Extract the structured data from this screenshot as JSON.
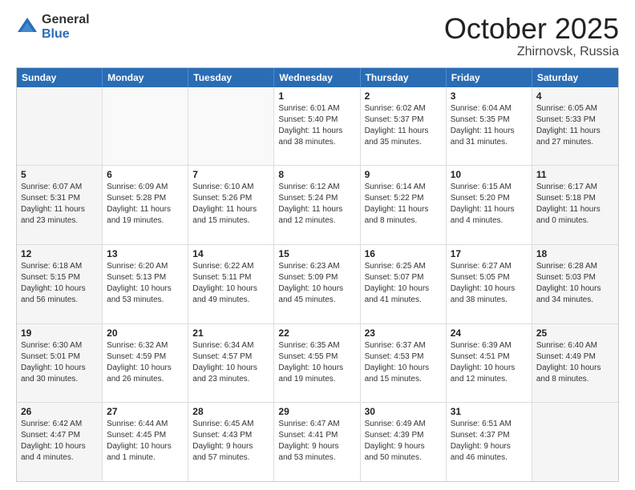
{
  "logo": {
    "general": "General",
    "blue": "Blue"
  },
  "header": {
    "month": "October 2025",
    "location": "Zhirnovsk, Russia"
  },
  "days": [
    "Sunday",
    "Monday",
    "Tuesday",
    "Wednesday",
    "Thursday",
    "Friday",
    "Saturday"
  ],
  "rows": [
    [
      {
        "day": "",
        "info": ""
      },
      {
        "day": "",
        "info": ""
      },
      {
        "day": "",
        "info": ""
      },
      {
        "day": "1",
        "info": "Sunrise: 6:01 AM\nSunset: 5:40 PM\nDaylight: 11 hours\nand 38 minutes."
      },
      {
        "day": "2",
        "info": "Sunrise: 6:02 AM\nSunset: 5:37 PM\nDaylight: 11 hours\nand 35 minutes."
      },
      {
        "day": "3",
        "info": "Sunrise: 6:04 AM\nSunset: 5:35 PM\nDaylight: 11 hours\nand 31 minutes."
      },
      {
        "day": "4",
        "info": "Sunrise: 6:05 AM\nSunset: 5:33 PM\nDaylight: 11 hours\nand 27 minutes."
      }
    ],
    [
      {
        "day": "5",
        "info": "Sunrise: 6:07 AM\nSunset: 5:31 PM\nDaylight: 11 hours\nand 23 minutes."
      },
      {
        "day": "6",
        "info": "Sunrise: 6:09 AM\nSunset: 5:28 PM\nDaylight: 11 hours\nand 19 minutes."
      },
      {
        "day": "7",
        "info": "Sunrise: 6:10 AM\nSunset: 5:26 PM\nDaylight: 11 hours\nand 15 minutes."
      },
      {
        "day": "8",
        "info": "Sunrise: 6:12 AM\nSunset: 5:24 PM\nDaylight: 11 hours\nand 12 minutes."
      },
      {
        "day": "9",
        "info": "Sunrise: 6:14 AM\nSunset: 5:22 PM\nDaylight: 11 hours\nand 8 minutes."
      },
      {
        "day": "10",
        "info": "Sunrise: 6:15 AM\nSunset: 5:20 PM\nDaylight: 11 hours\nand 4 minutes."
      },
      {
        "day": "11",
        "info": "Sunrise: 6:17 AM\nSunset: 5:18 PM\nDaylight: 11 hours\nand 0 minutes."
      }
    ],
    [
      {
        "day": "12",
        "info": "Sunrise: 6:18 AM\nSunset: 5:15 PM\nDaylight: 10 hours\nand 56 minutes."
      },
      {
        "day": "13",
        "info": "Sunrise: 6:20 AM\nSunset: 5:13 PM\nDaylight: 10 hours\nand 53 minutes."
      },
      {
        "day": "14",
        "info": "Sunrise: 6:22 AM\nSunset: 5:11 PM\nDaylight: 10 hours\nand 49 minutes."
      },
      {
        "day": "15",
        "info": "Sunrise: 6:23 AM\nSunset: 5:09 PM\nDaylight: 10 hours\nand 45 minutes."
      },
      {
        "day": "16",
        "info": "Sunrise: 6:25 AM\nSunset: 5:07 PM\nDaylight: 10 hours\nand 41 minutes."
      },
      {
        "day": "17",
        "info": "Sunrise: 6:27 AM\nSunset: 5:05 PM\nDaylight: 10 hours\nand 38 minutes."
      },
      {
        "day": "18",
        "info": "Sunrise: 6:28 AM\nSunset: 5:03 PM\nDaylight: 10 hours\nand 34 minutes."
      }
    ],
    [
      {
        "day": "19",
        "info": "Sunrise: 6:30 AM\nSunset: 5:01 PM\nDaylight: 10 hours\nand 30 minutes."
      },
      {
        "day": "20",
        "info": "Sunrise: 6:32 AM\nSunset: 4:59 PM\nDaylight: 10 hours\nand 26 minutes."
      },
      {
        "day": "21",
        "info": "Sunrise: 6:34 AM\nSunset: 4:57 PM\nDaylight: 10 hours\nand 23 minutes."
      },
      {
        "day": "22",
        "info": "Sunrise: 6:35 AM\nSunset: 4:55 PM\nDaylight: 10 hours\nand 19 minutes."
      },
      {
        "day": "23",
        "info": "Sunrise: 6:37 AM\nSunset: 4:53 PM\nDaylight: 10 hours\nand 15 minutes."
      },
      {
        "day": "24",
        "info": "Sunrise: 6:39 AM\nSunset: 4:51 PM\nDaylight: 10 hours\nand 12 minutes."
      },
      {
        "day": "25",
        "info": "Sunrise: 6:40 AM\nSunset: 4:49 PM\nDaylight: 10 hours\nand 8 minutes."
      }
    ],
    [
      {
        "day": "26",
        "info": "Sunrise: 6:42 AM\nSunset: 4:47 PM\nDaylight: 10 hours\nand 4 minutes."
      },
      {
        "day": "27",
        "info": "Sunrise: 6:44 AM\nSunset: 4:45 PM\nDaylight: 10 hours\nand 1 minute."
      },
      {
        "day": "28",
        "info": "Sunrise: 6:45 AM\nSunset: 4:43 PM\nDaylight: 9 hours\nand 57 minutes."
      },
      {
        "day": "29",
        "info": "Sunrise: 6:47 AM\nSunset: 4:41 PM\nDaylight: 9 hours\nand 53 minutes."
      },
      {
        "day": "30",
        "info": "Sunrise: 6:49 AM\nSunset: 4:39 PM\nDaylight: 9 hours\nand 50 minutes."
      },
      {
        "day": "31",
        "info": "Sunrise: 6:51 AM\nSunset: 4:37 PM\nDaylight: 9 hours\nand 46 minutes."
      },
      {
        "day": "",
        "info": ""
      }
    ]
  ]
}
